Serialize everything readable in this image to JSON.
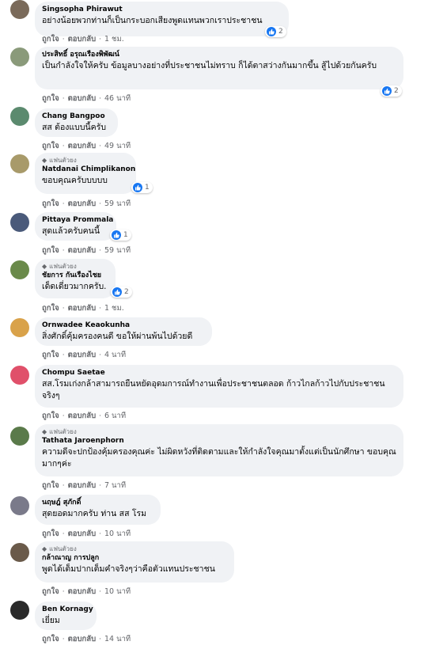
{
  "labels": {
    "like": "ถูกใจ",
    "reply": "ตอบกลับ",
    "dot": "·"
  },
  "comments": [
    {
      "name": "Singsopha Phirawut",
      "fan": false,
      "text": "อย่างน้อยพวกท่านก็เป็นกระบอกเสียงพูดแทนพวกเราประชาชน",
      "time": "1 ชม.",
      "reactions": "2",
      "avatar_color": "#7a6a5a"
    },
    {
      "name": "ประสิทธิ์ อรุณเรืองพิพัฒน์",
      "fan": false,
      "text": "เป็นกำลังใจให้ครับ ข้อมูลบางอย่างที่ประชาชนไม่ทราบ ก็ได้ตาสว่างกันมากขึ้น สู้ไปด้วยกันครับ",
      "time": "46 นาที",
      "reactions": "2",
      "avatar_color": "#8a9a7a"
    },
    {
      "name": "Chang Bangpoo",
      "fan": false,
      "text": "สส ต้องแบบนี้ครับ",
      "time": "49 นาที",
      "reactions": null,
      "avatar_color": "#5b8a6e"
    },
    {
      "name": "Natdanai Chimplikanon",
      "fan": true,
      "text": "ขอบคุณครับบบบบ",
      "time": "59 นาที",
      "reactions": "1",
      "avatar_color": "#a89a6a"
    },
    {
      "name": "Pittaya Prommala",
      "fan": false,
      "text": "สุดแล้วครับคนนี้",
      "time": "59 นาที",
      "reactions": "1",
      "avatar_color": "#4a5a7a"
    },
    {
      "name": "ชัยการ กันเรืองไชย",
      "fan": true,
      "text": "เด็ดเดี่ยวมากครับ.",
      "time": "1 ชม.",
      "reactions": "2",
      "avatar_color": "#6a8a4a"
    },
    {
      "name": "Ornwadee Keaokunha",
      "fan": false,
      "text": "สิ่งศักดิ์คุ้มครองคนดี ขอให้ผ่านพ้นไปด้วยดี",
      "time": "4 นาที",
      "reactions": null,
      "avatar_color": "#d9a24a"
    },
    {
      "name": "Chompu Saetae",
      "fan": false,
      "text": "สส.โรมเก่งกล้าสามารถยืนหยัดอุดมการณ์ทำงานเพื่อประชาชนตลอด ก้าวไกลก้าวไปกับประชาชนจริงๆ",
      "time": "6 นาที",
      "reactions": null,
      "avatar_color": "#e0506a"
    },
    {
      "name": "Tathata Jaroenphorn",
      "fan": true,
      "text": "ความดีจะปกป้องคุ้มครองคุณค่ะ ไม่ผิดหวังที่ติดตามและให้กำลังใจคุณมาตั้งแต่เป็นนักศึกษา ขอบคุณมากๆค่ะ",
      "time": "7 นาที",
      "reactions": null,
      "avatar_color": "#5a7a4a"
    },
    {
      "name": "นฤษฎ์ สุภักดิ์",
      "fan": false,
      "text": "สุดยอดมากครับ ท่าน สส โรม",
      "time": "10 นาที",
      "reactions": null,
      "avatar_color": "#7a7a8a"
    },
    {
      "name": "กล้าณาญ การปลูก",
      "fan": true,
      "text": "พูดได้เต็มปากเต็มคำจริงๆว่าคือตัวแทนประชาชน",
      "time": "10 นาที",
      "reactions": null,
      "avatar_color": "#6a5a4a"
    },
    {
      "name": "Ben Kornagy",
      "fan": false,
      "text": "เยี่ยม",
      "time": "14 นาที",
      "reactions": null,
      "avatar_color": "#2a2a2a"
    }
  ],
  "fan_label": "แฟนตัวยง",
  "icons": {
    "like": "thumbs-up-icon",
    "fan": "diamond-icon"
  },
  "accent": "#1877f2"
}
